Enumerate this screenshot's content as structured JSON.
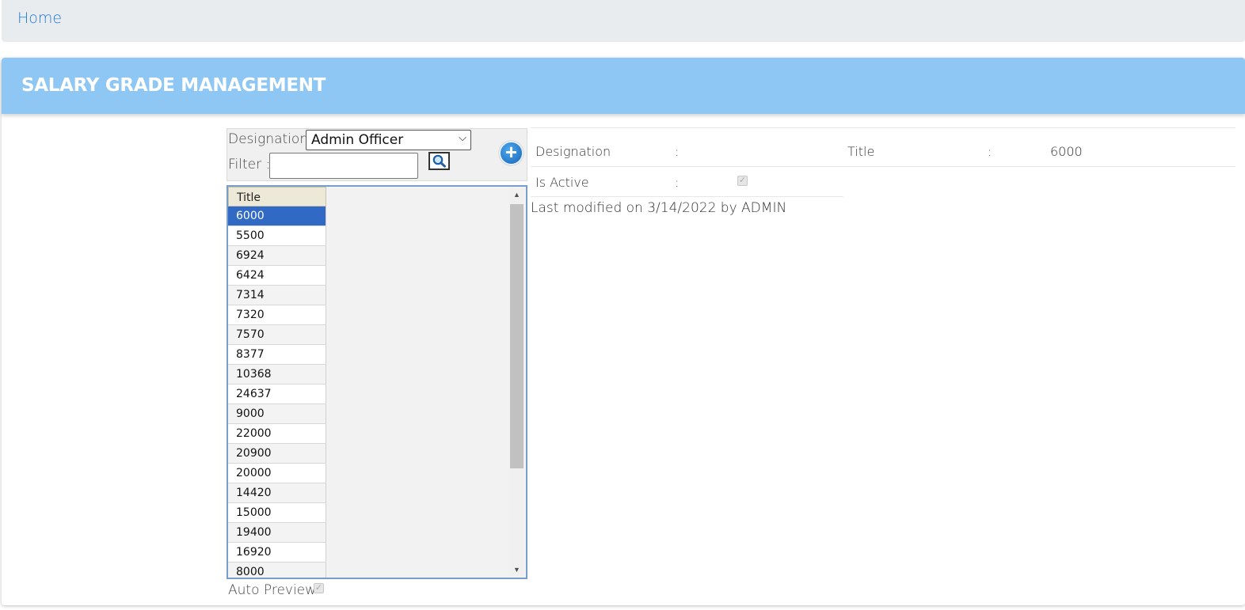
{
  "breadcrumb": {
    "home": "Home"
  },
  "header": {
    "title": "SALARY GRADE MANAGEMENT"
  },
  "search": {
    "designation_label": "Designation",
    "designation_value": "Admin Officer",
    "filter_label": "Filter :",
    "filter_value": ""
  },
  "grid": {
    "column": "Title",
    "rows": [
      "6000",
      "5500",
      "6924",
      "6424",
      "7314",
      "7320",
      "7570",
      "8377",
      "10368",
      "24637",
      "9000",
      "22000",
      "20900",
      "20000",
      "14420",
      "15000",
      "19400",
      "16920",
      "8000"
    ],
    "selected_index": 0
  },
  "auto_preview": {
    "label": "Auto Preview",
    "checked": true
  },
  "detail": {
    "designation_label": "Designation",
    "designation_sep": ":",
    "designation_value": "",
    "title_label": "Title",
    "title_sep": ":",
    "title_value": "6000",
    "is_active_label": "Is Active",
    "is_active_sep": ":",
    "is_active": true,
    "modified": "Last modified on 3/14/2022 by ADMIN"
  },
  "colors": {
    "header": "#8fc7f4",
    "selected_row": "#316ac5",
    "link": "#1f7ad9"
  }
}
